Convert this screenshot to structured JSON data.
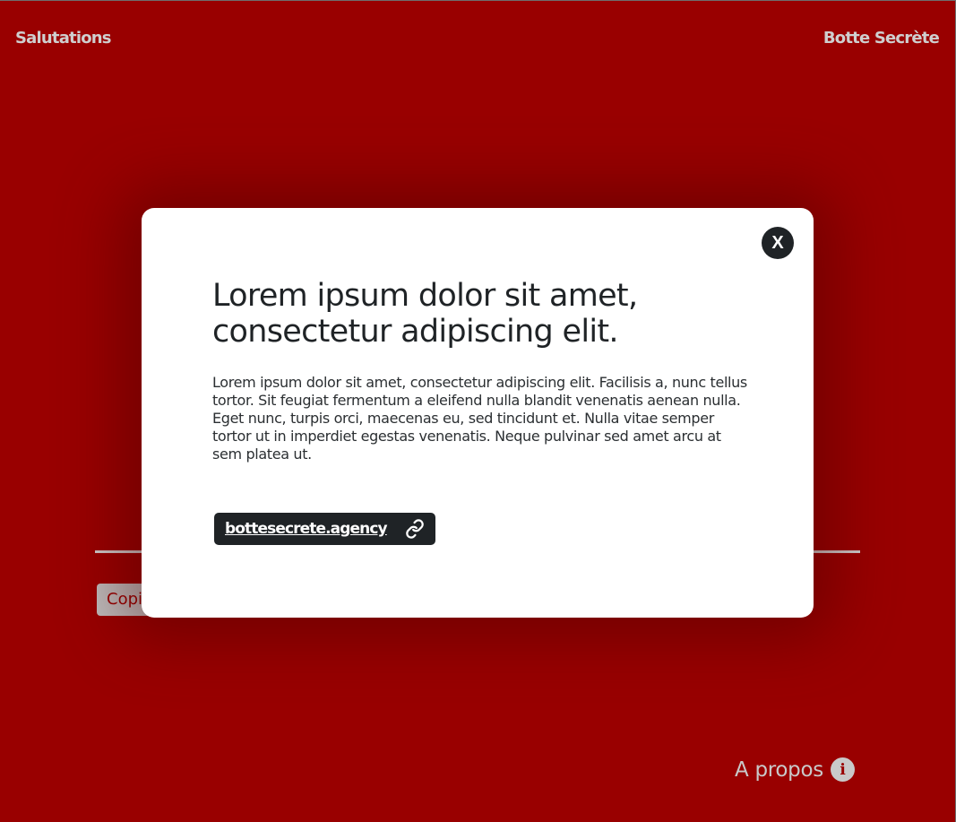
{
  "header": {
    "left_label": "Salutations",
    "right_label": "Botte Secrète"
  },
  "background": {
    "copy_label": "Copi"
  },
  "footer": {
    "about_label": "A propos",
    "about_icon": "info-icon"
  },
  "modal": {
    "close_label": "X",
    "title": "Lorem ipsum dolor sit amet, consectetur adipiscing elit.",
    "body": "Lorem ipsum dolor sit amet, consectetur adipiscing elit. Facilisis a, nunc tellus tortor. Sit feugiat fermentum a eleifend nulla blandit venenatis aenean nulla. Eget nunc, turpis orci, maecenas eu, sed tincidunt et. Nulla vitae semper tortor ut in imperdiet egestas venenatis. Neque pulvinar sed amet arcu at sem platea ut.",
    "link_label": "bottesecrete.agency",
    "link_icon": "link-icon"
  },
  "colors": {
    "background": "#990000",
    "modal": "#ffffff",
    "dark": "#1f2326",
    "muted": "#cfcfcf"
  }
}
